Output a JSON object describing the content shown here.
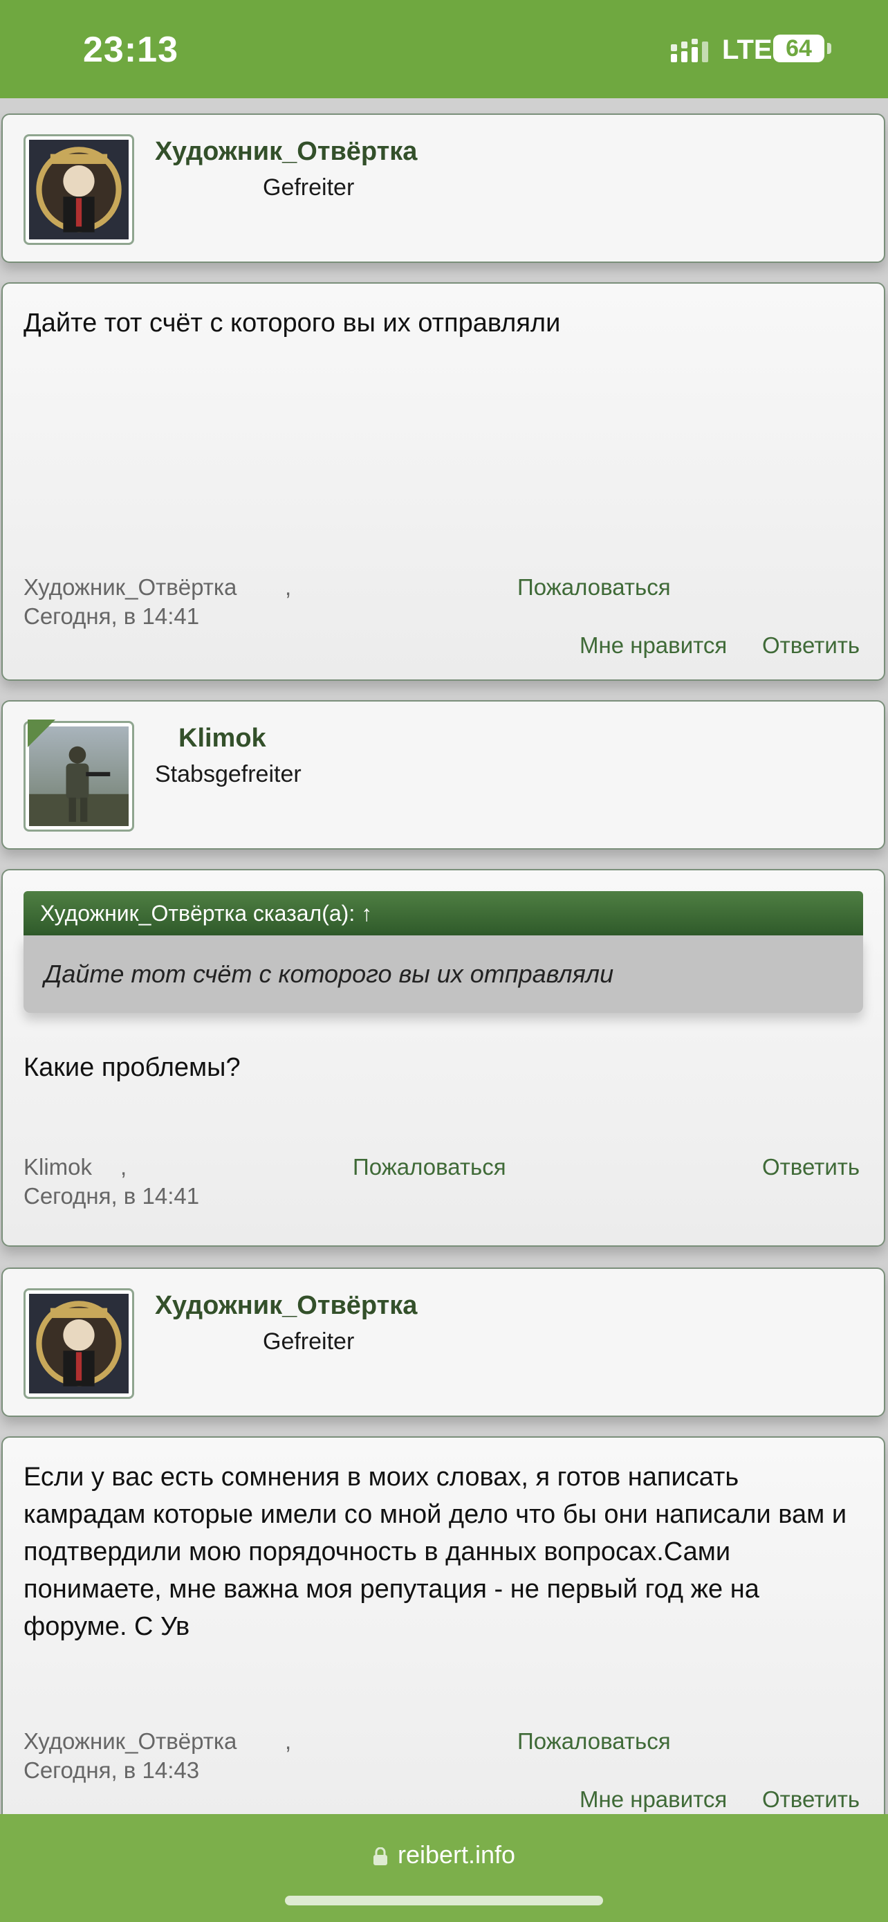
{
  "status_bar": {
    "time": "23:13",
    "network": "LTE",
    "battery": "64"
  },
  "posts": [
    {
      "author": "Художник_Отвёртка",
      "rank": "Gefreiter",
      "text": "Дайте тот счёт с которого вы их отправляли",
      "meta_author": "Художник_Отвёртка",
      "date": "Сегодня, в 14:41",
      "report_label": "Пожаловаться",
      "like_label": "Мне нравится",
      "reply_label": "Ответить"
    },
    {
      "author": "Klimok",
      "rank": "Stabsgefreiter",
      "quote_header": "Художник_Отвёртка сказал(а): ↑",
      "quote_text": "Дайте тот счёт с которого вы их отправляли",
      "text": "Какие проблемы?",
      "meta_author": "Klimok",
      "date": "Сегодня, в 14:41",
      "report_label": "Пожаловаться",
      "reply_label": "Ответить"
    },
    {
      "author": "Художник_Отвёртка",
      "rank": "Gefreiter",
      "text": "Если у вас есть сомнения в моих словах, я готов написать камрадам которые имели со мной дело что бы они написали вам и подтвердили мою порядочность в данных вопросах.Сами понимаете, мне важна моя репутация - не первый год же на форуме. С Ув",
      "meta_author": "Художник_Отвёртка",
      "date": "Сегодня, в 14:43",
      "report_label": "Пожаловаться",
      "like_label": "Мне нравится",
      "reply_label": "Ответить"
    }
  ],
  "meta_separator": ",",
  "browser": {
    "url": "reibert.info"
  },
  "colors": {
    "accent": "#6fa840",
    "link": "#3f6a37",
    "username": "#33502a",
    "quote_header": "#3d6a35"
  }
}
